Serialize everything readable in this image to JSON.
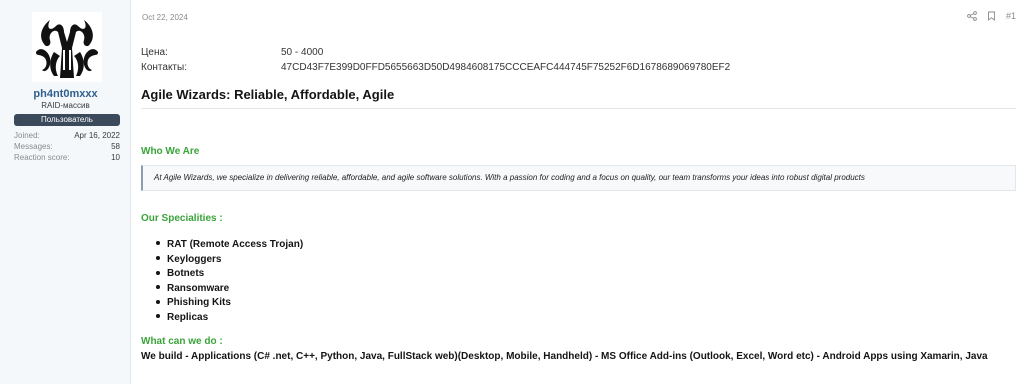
{
  "user": {
    "name": "ph4nt0mxxx",
    "title": "RAID-массив",
    "banner": "Пользователь",
    "stats": [
      {
        "label": "Joined:",
        "value": "Apr 16, 2022"
      },
      {
        "label": "Messages:",
        "value": "58"
      },
      {
        "label": "Reaction score:",
        "value": "10"
      }
    ]
  },
  "post": {
    "date": "Oct 22, 2024",
    "number": "#1",
    "price_label": "Цена:",
    "price_value": "50 - 4000",
    "contacts_label": "Контакты:",
    "contacts_value": "47CD43F7E399D0FFD5655663D50D4984608175CCCEAFC444745F75252F6D1678689069780EF2",
    "headline": "Agile Wizards: Reliable, Affordable, Agile",
    "who_heading": "Who We Are",
    "who_quote": "At Agile Wizards, we specialize in delivering reliable, affordable, and agile software solutions. With a passion for coding and a focus on quality, our team transforms your ideas into robust digital products",
    "spec_heading": "Our Specialities :",
    "specialities": [
      "RAT (Remote Access Trojan)",
      "Keyloggers",
      "Botnets",
      "Ransomware",
      "Phishing Kits",
      "Replicas"
    ],
    "what_heading": "What can we do :",
    "what_text": "We build - Applications (C# .net, C++, Python, Java, FullStack web)(Desktop, Mobile, Handheld) - MS Office Add-ins (Outlook, Excel, Word etc) - Android Apps using Xamarin, Java"
  },
  "icons": {
    "share": "share-icon",
    "bookmark": "bookmark-icon"
  },
  "colors": {
    "accent_green": "#3aa43a",
    "username": "#2f5f8f",
    "banner_bg": "#3a4a5a"
  }
}
